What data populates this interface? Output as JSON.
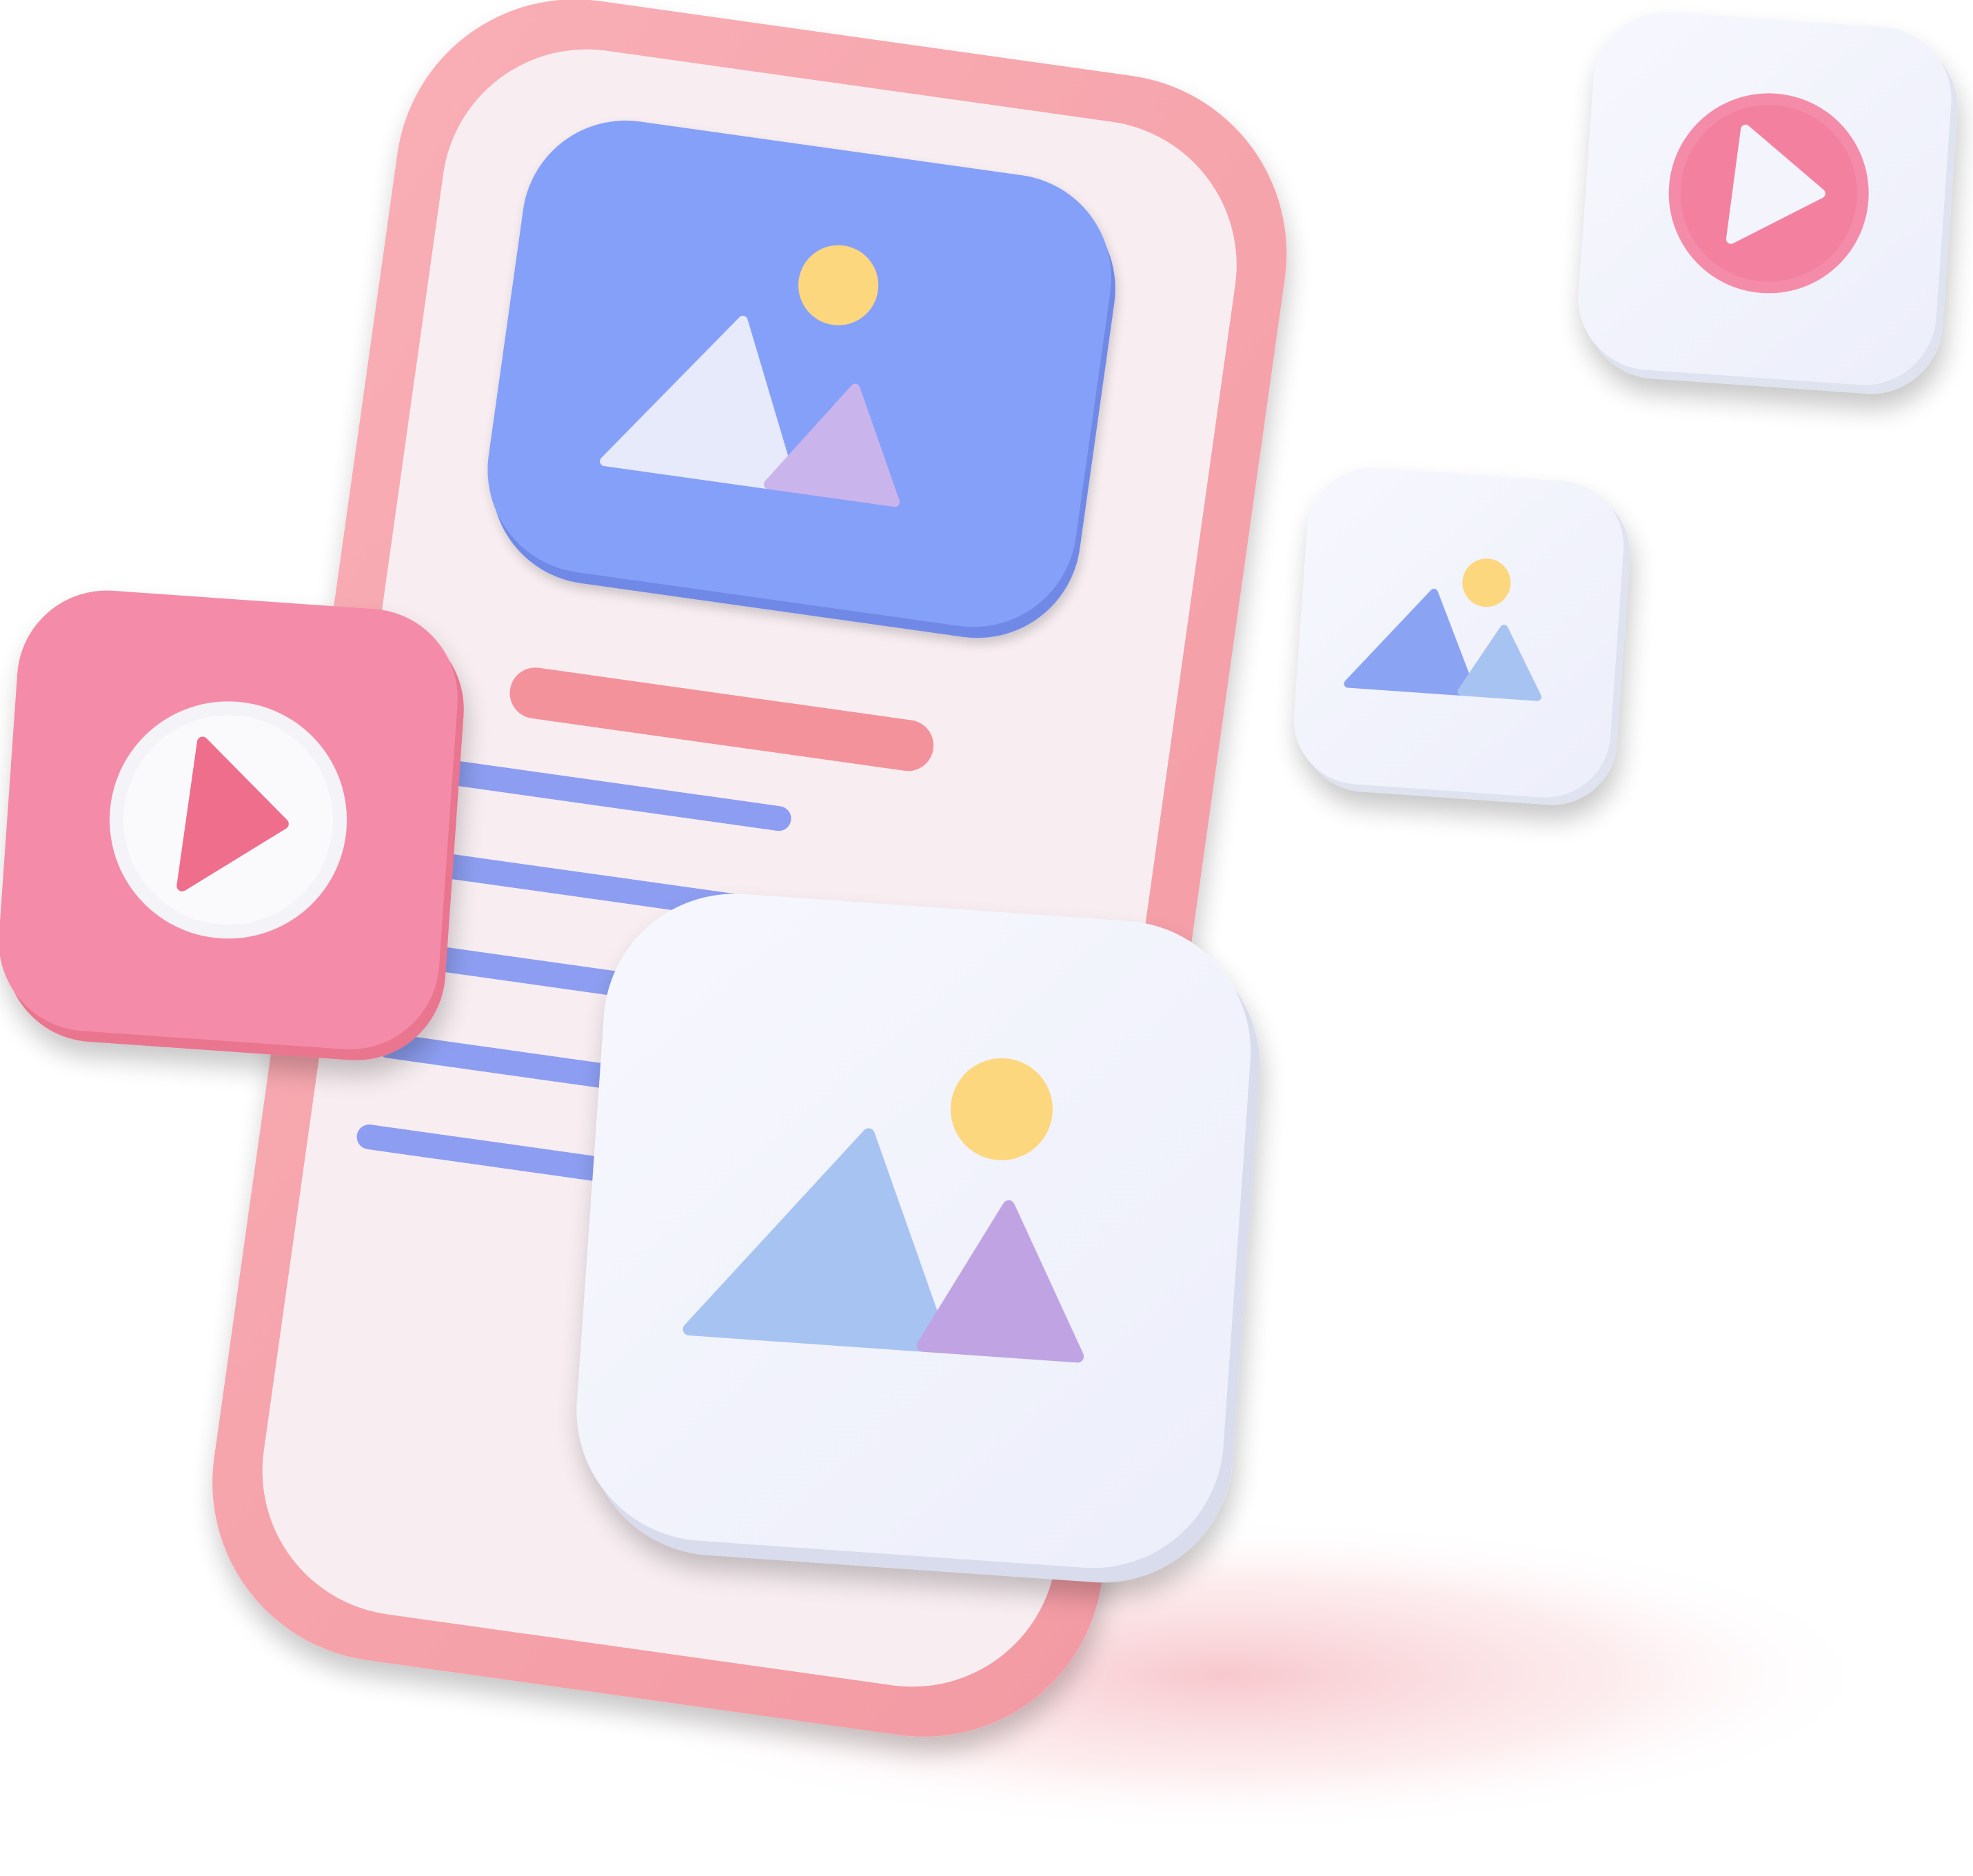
{
  "scene": {
    "kind": "3d-illustration",
    "subject": "phone-with-media-icons",
    "colors": {
      "background": "#ffffff",
      "phone_frame": "#f7a4ac",
      "phone_frame_dark": "#ef8f98",
      "phone_screen": "#f8eef2",
      "hero_card": "#85a0f8",
      "hero_card_shadow": "#6f89e6",
      "mountain_light": "#e6eafb",
      "mountain_purple": "#c9b4ec",
      "mountain_blue": "#a7c3f2",
      "mountain_blue_dark": "#8aa3f3",
      "mountain_violet": "#bfa3e3",
      "sun": "#fdd77e",
      "title_bar": "#f4929c",
      "text_line": "#8d9ef2",
      "play_tile": "#f48ba8",
      "play_accent": "#ee6e8c",
      "card_white": "#f3f4fc",
      "card_edge": "#d9dcec",
      "floor_glow": "#f8cdd2"
    },
    "icons": [
      "image-icon",
      "play-icon",
      "image-icon",
      "image-icon",
      "play-icon"
    ]
  }
}
